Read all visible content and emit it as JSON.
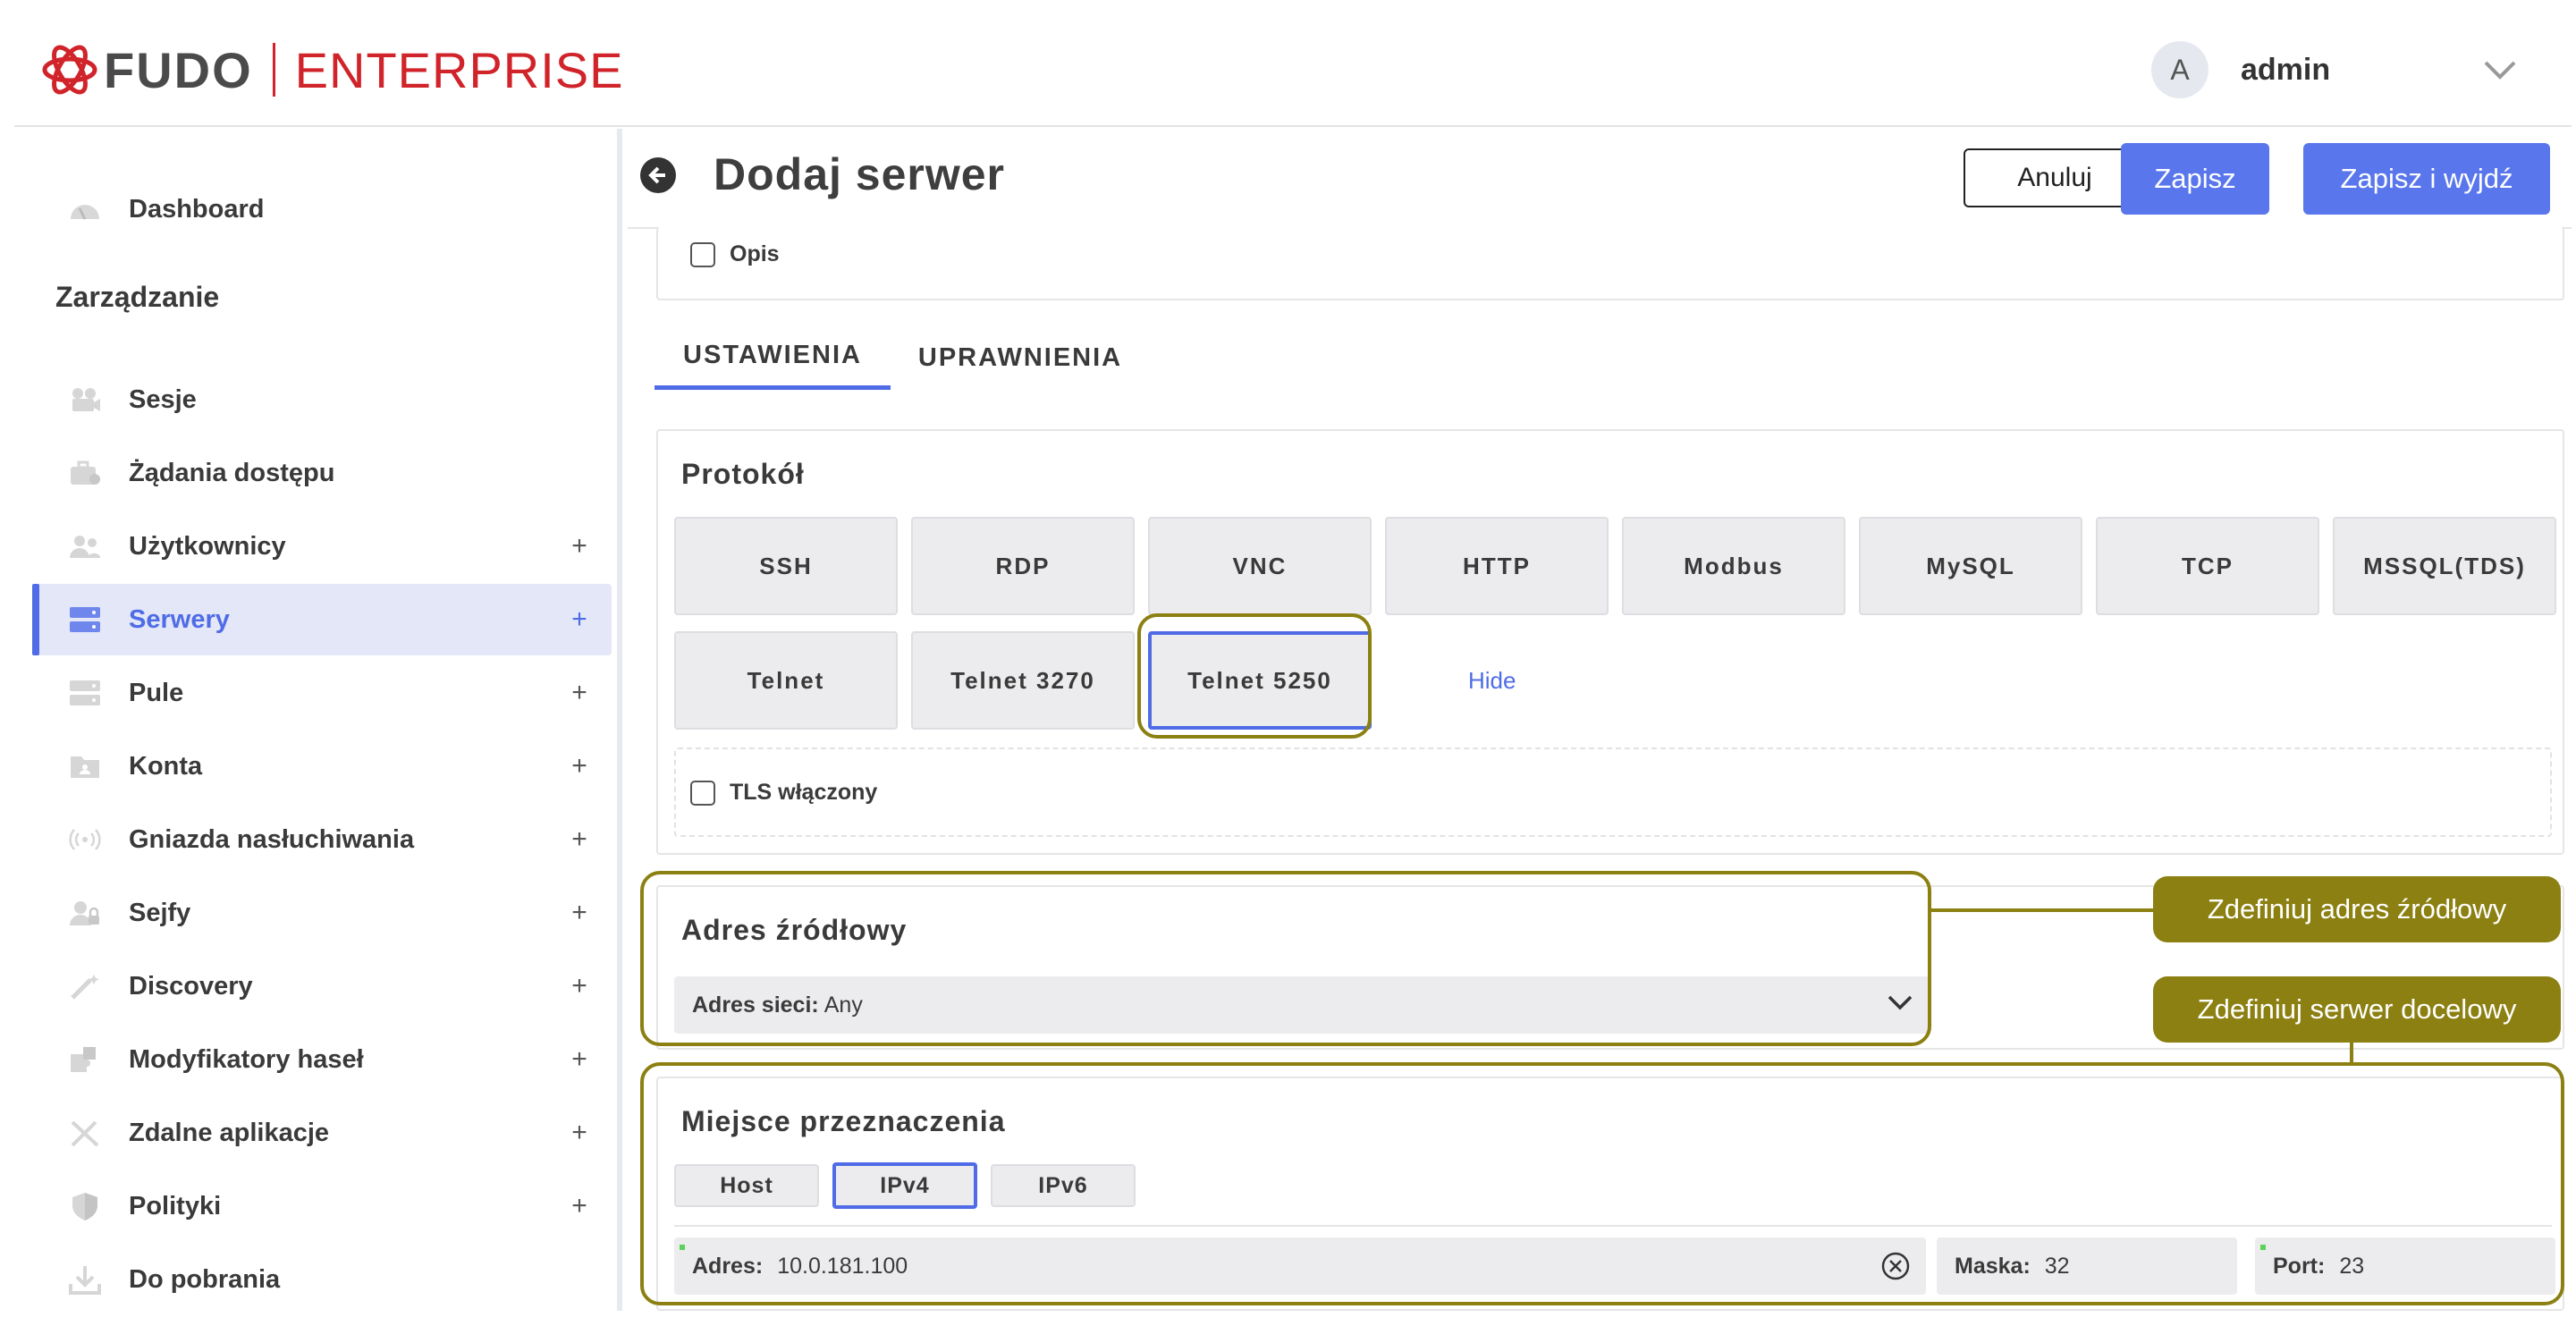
{
  "brand": {
    "name": "FUDO",
    "edition": "ENTERPRISE"
  },
  "user": {
    "avatar_letter": "A",
    "name": "admin"
  },
  "sidebar": {
    "dashboard": "Dashboard",
    "section_heading": "Zarządzanie",
    "items": [
      {
        "label": "Sesje",
        "icon": "camera-icon",
        "plus": ""
      },
      {
        "label": "Żądania dostępu",
        "icon": "briefcase-icon",
        "plus": ""
      },
      {
        "label": "Użytkownicy",
        "icon": "users-icon",
        "plus": "+"
      },
      {
        "label": "Serwery",
        "icon": "server-icon",
        "plus": "+"
      },
      {
        "label": "Pule",
        "icon": "pool-icon",
        "plus": "+"
      },
      {
        "label": "Konta",
        "icon": "account-folder-icon",
        "plus": "+"
      },
      {
        "label": "Gniazda nasłuchiwania",
        "icon": "broadcast-icon",
        "plus": "+"
      },
      {
        "label": "Sejfy",
        "icon": "safe-user-icon",
        "plus": "+"
      },
      {
        "label": "Discovery",
        "icon": "magic-wand-icon",
        "plus": "+"
      },
      {
        "label": "Modyfikatory haseł",
        "icon": "puzzle-icon",
        "plus": "+"
      },
      {
        "label": "Zdalne aplikacje",
        "icon": "remote-app-icon",
        "plus": "+"
      },
      {
        "label": "Polityki",
        "icon": "shield-icon",
        "plus": "+"
      },
      {
        "label": "Do pobrania",
        "icon": "download-icon",
        "plus": ""
      }
    ]
  },
  "header": {
    "title": "Dodaj serwer",
    "cancel": "Anuluj",
    "save": "Zapisz",
    "save_exit": "Zapisz i wyjdź"
  },
  "opis_label": "Opis",
  "tabs": [
    "USTAWIENIA",
    "UPRAWNIENIA"
  ],
  "protocol": {
    "title": "Protokół",
    "options": [
      "SSH",
      "RDP",
      "VNC",
      "HTTP",
      "Modbus",
      "MySQL",
      "TCP",
      "MSSQL(TDS)",
      "Telnet",
      "Telnet 3270",
      "Telnet 5250"
    ],
    "selected": "Telnet 5250",
    "hide": "Hide",
    "tls_label": "TLS włączony"
  },
  "source": {
    "title": "Adres źródłowy",
    "network_label": "Adres sieci:",
    "network_value": "Any"
  },
  "destination": {
    "title": "Miejsce przeznaczenia",
    "modes": [
      "Host",
      "IPv4",
      "IPv6"
    ],
    "selected_mode": "IPv4",
    "address_label": "Adres:",
    "address_value": "10.0.181.100",
    "mask_label": "Maska:",
    "mask_value": "32",
    "port_label": "Port:",
    "port_value": "23"
  },
  "callouts": {
    "source": "Zdefiniuj adres źródłowy",
    "destination": "Zdefiniuj serwer docelowy"
  },
  "colors": {
    "accent": "#4f6ce6",
    "primary_button": "#5976ec",
    "brand_red": "#d1232a",
    "annotation": "#8b8011"
  }
}
